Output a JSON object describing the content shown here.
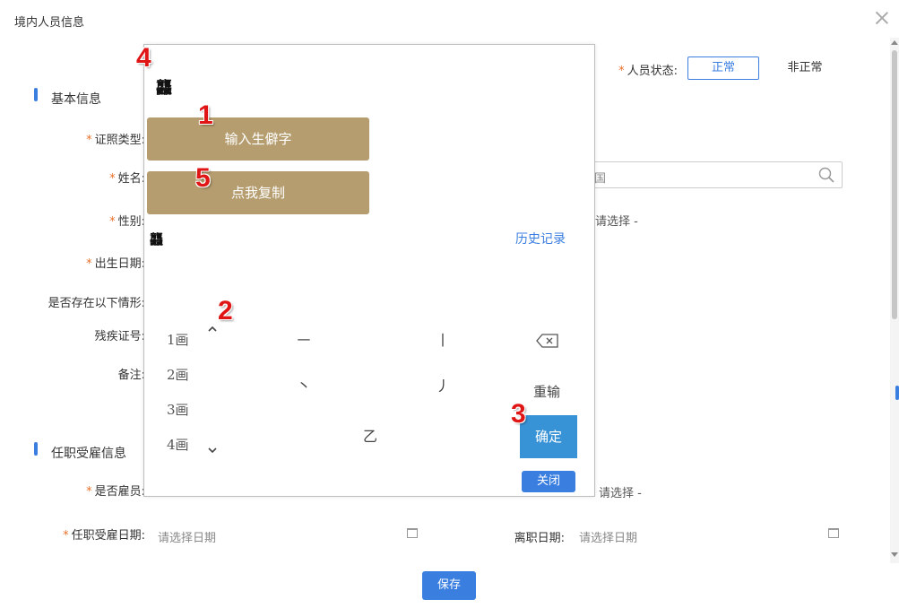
{
  "dialog": {
    "title": "境内人员信息"
  },
  "status": {
    "label": "人员状态:",
    "normal": "正常",
    "abnormal": "非正常"
  },
  "sections": {
    "basic": "基本信息",
    "employment": "任职受雇信息"
  },
  "fields": {
    "id_type": "证照类型:",
    "name": "姓名:",
    "gender": "性别:",
    "birth": "出生日期:",
    "situation": "是否存在以下情形:",
    "disability": "残疾证号:",
    "remark": "备注:",
    "employed": "是否雇员:",
    "hire_date": "任职受雇日期:",
    "leave_date": "离职日期:"
  },
  "values": {
    "nation": "国",
    "gender_select": "请选择 -",
    "employed_select": "请选择 -",
    "date_placeholder": "请选择日期"
  },
  "popup": {
    "preview_char": "龘",
    "input_button": "输入生僻字",
    "copy_button": "点我复制",
    "result_char": "龘",
    "history": "历史记录",
    "stroke_categories": [
      "1画",
      "2画",
      "3画",
      "4画"
    ],
    "strokes": [
      "㇐",
      "丨",
      "丶",
      "丿",
      "乙"
    ],
    "reset": "重输",
    "confirm": "确定",
    "close": "关闭"
  },
  "annotations": [
    "1",
    "2",
    "3",
    "4",
    "5"
  ],
  "save": "保存",
  "colors": {
    "accent": "#3a7ee0",
    "gold": "#b59d6f",
    "confirm": "#3892d6",
    "required": "#e8702a",
    "badge": "#e01515"
  }
}
